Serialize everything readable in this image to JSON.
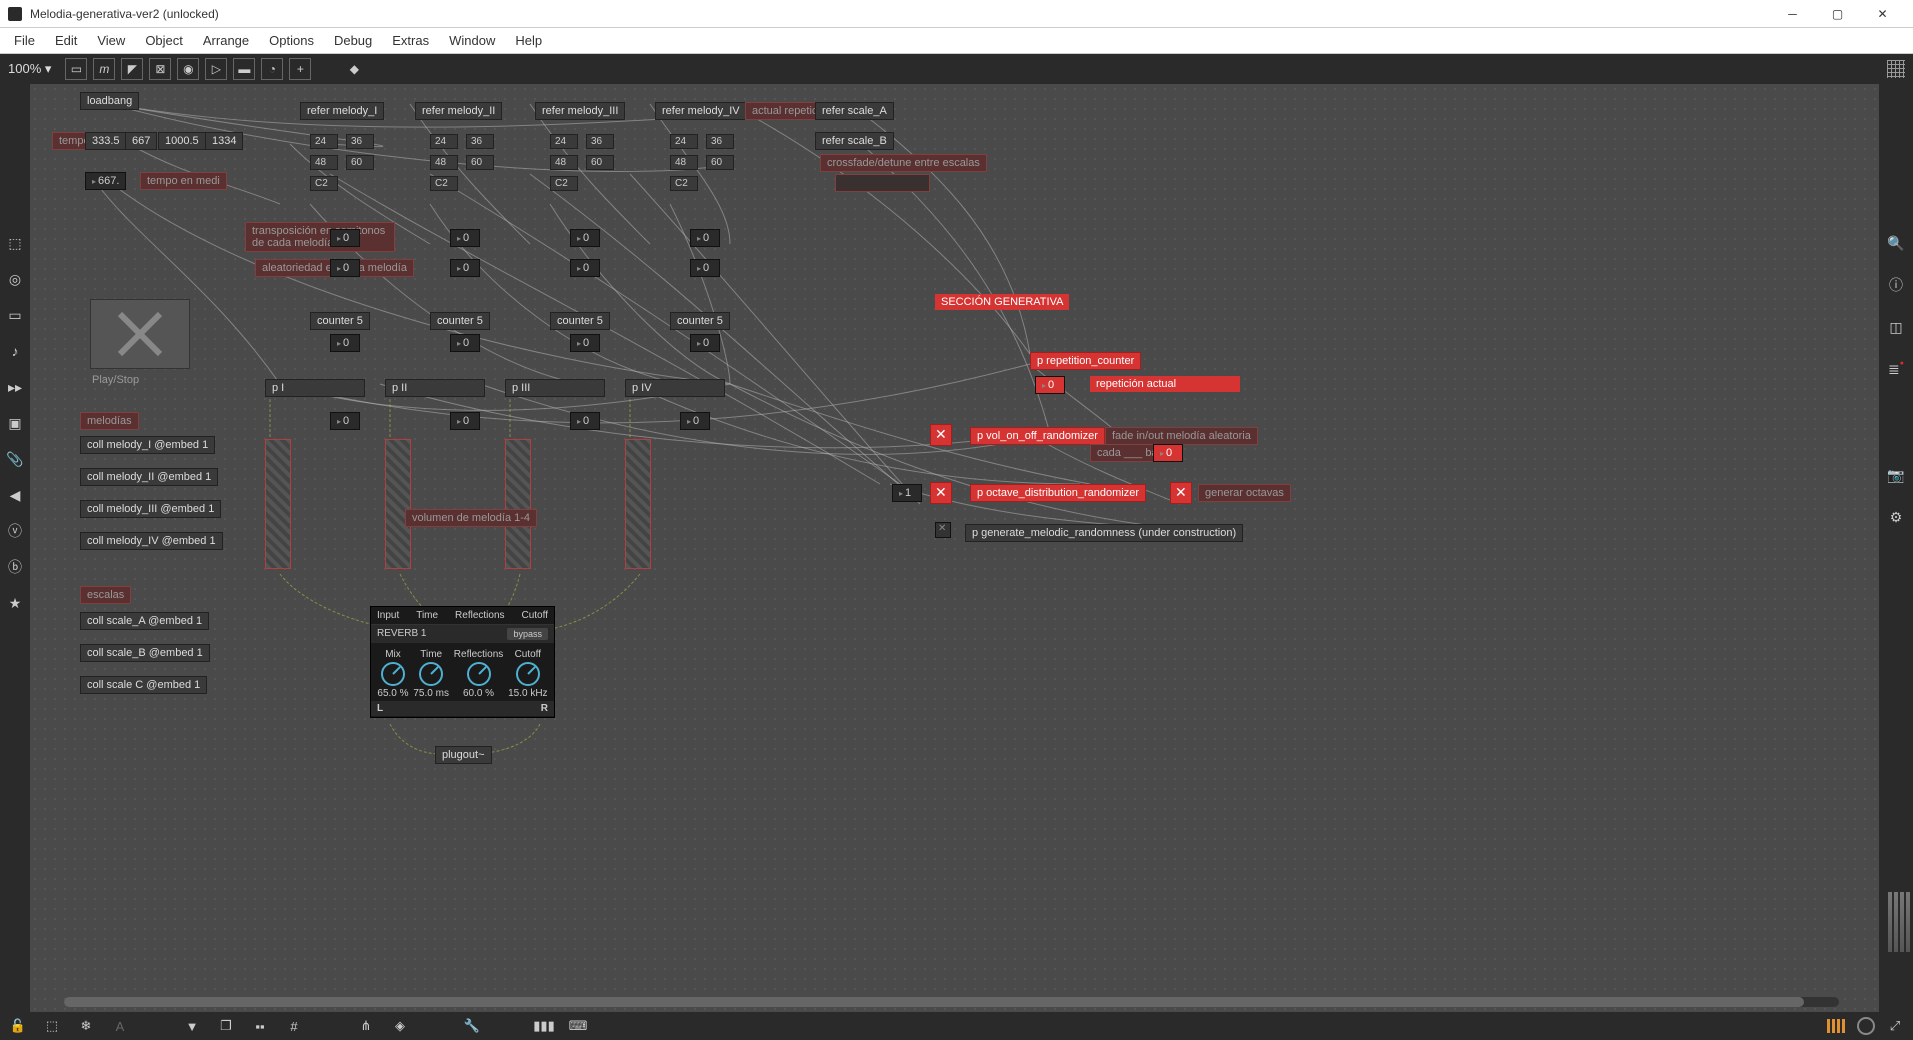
{
  "window": {
    "title": "Melodia-generativa-ver2 (unlocked)"
  },
  "menu": [
    "File",
    "Edit",
    "View",
    "Object",
    "Arrange",
    "Options",
    "Debug",
    "Extras",
    "Window",
    "Help"
  ],
  "zoom": "100% ▾",
  "patcher": {
    "loadbang": "loadbang",
    "tempo_label": "tempo",
    "tempo_vals": [
      "333.5",
      "667",
      "1000.5",
      "1334"
    ],
    "metro": "667.",
    "tempo_comment": "tempo en medi",
    "refer": [
      "refer melody_I",
      "refer melody_II",
      "refer melody_III",
      "refer melody_IV"
    ],
    "refer_scales": [
      "refer scale_A",
      "refer scale_B"
    ],
    "actual_rep": "actual repetición",
    "crossfade": "crossfade/detune entre escalas",
    "col_rows": {
      "r1": [
        "24",
        "36",
        "24",
        "36",
        "24",
        "36",
        "24",
        "36"
      ],
      "r2": [
        "48",
        "60",
        "48",
        "60",
        "48",
        "60",
        "48",
        "60"
      ],
      "note": [
        "C2",
        "C2",
        "C2",
        "C2"
      ],
      "zeros": [
        "0",
        "0",
        "0",
        "0"
      ],
      "zeros2": [
        "0",
        "0",
        "0",
        "0"
      ],
      "counters": [
        "counter 5",
        "counter 5",
        "counter 5",
        "counter 5"
      ],
      "cnt_zeros": [
        "0",
        "0",
        "0",
        "0"
      ]
    },
    "transpose_comment": "transposición en semitonos de cada melodía",
    "aleator_comment": "aleatoriedad en cada melodía",
    "playstop": "Play/Stop",
    "p_objs": [
      "p I",
      "p II",
      "p III",
      "p IV"
    ],
    "p_zeros": [
      "0",
      "0",
      "0",
      "0"
    ],
    "melodias": "melodías",
    "colls": [
      "coll melody_I @embed 1",
      "coll melody_II @embed 1",
      "coll melody_III @embed 1",
      "coll melody_IV @embed 1"
    ],
    "vol_comment": "volumen de melodía 1-4",
    "escalas": "escalas",
    "scale_colls": [
      "coll scale_A @embed 1",
      "coll scale_B @embed 1",
      "coll scale C @embed 1"
    ],
    "plugout": "plugout~",
    "seccion": "SECCIÓN GENERATIVA",
    "p_rep_counter": "p repetition_counter",
    "rep_zero": "0",
    "rep_actual": "repetición actual",
    "p_vol_rand": "p vol_on_off_randomizer",
    "fade_comment": "fade in/out melodía aleatoria",
    "cada_bars": "cada ___ bars",
    "fade_zero": "0",
    "p_octave_rand": "p octave_distribution_randomizer",
    "one": "1",
    "gen_octavas": "generar octavas",
    "p_gen_melodic": "p generate_melodic_randomness (under construction)"
  },
  "reverb": {
    "tabs": [
      "Input",
      "Time",
      "Reflections",
      "Cutoff"
    ],
    "name": "REVERB 1",
    "bypass": "bypass",
    "params": [
      {
        "label": "Mix",
        "value": "65.0 %"
      },
      {
        "label": "Time",
        "value": "75.0 ms"
      },
      {
        "label": "Reflections",
        "value": "60.0 %"
      },
      {
        "label": "Cutoff",
        "value": "15.0 kHz"
      }
    ],
    "L": "L",
    "R": "R"
  }
}
